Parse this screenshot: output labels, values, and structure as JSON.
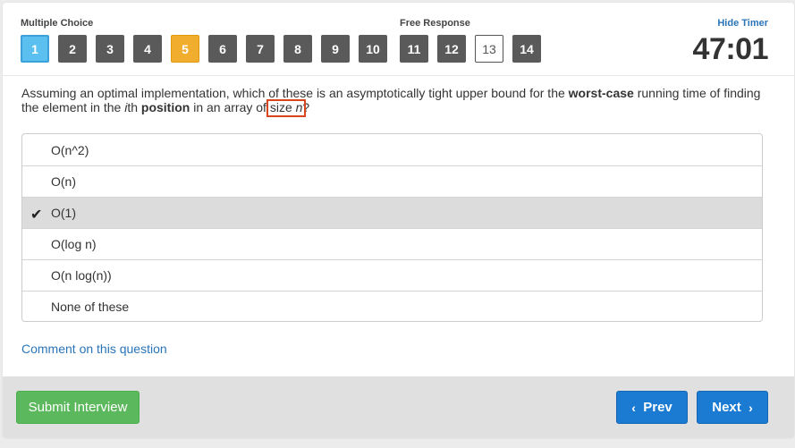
{
  "header": {
    "multiple_choice_label": "Multiple Choice",
    "free_response_label": "Free Response",
    "hide_timer_label": "Hide Timer",
    "timer": "47:01"
  },
  "question_nav": {
    "items": [
      {
        "label": "1",
        "state": "active"
      },
      {
        "label": "2",
        "state": "answered"
      },
      {
        "label": "3",
        "state": "answered"
      },
      {
        "label": "4",
        "state": "answered"
      },
      {
        "label": "5",
        "state": "flagged"
      },
      {
        "label": "6",
        "state": "answered"
      },
      {
        "label": "7",
        "state": "answered"
      },
      {
        "label": "8",
        "state": "answered"
      },
      {
        "label": "9",
        "state": "answered"
      },
      {
        "label": "10",
        "state": "answered"
      },
      {
        "label": "11",
        "state": "answered"
      },
      {
        "label": "12",
        "state": "answered"
      },
      {
        "label": "13",
        "state": "unanswered"
      },
      {
        "label": "14",
        "state": "answered"
      }
    ]
  },
  "question": {
    "part1": "Assuming an optimal implementation, which of these is an asymptotically tight upper bound for the ",
    "bold1": "worst-case",
    "part2": " running time of finding the element in the ",
    "italic_i": "i",
    "part3": "th ",
    "bold2": "position",
    "part4": " in an ",
    "highlight": "array",
    "part5": " of size ",
    "italic_n": "n",
    "part6": "?"
  },
  "options": [
    {
      "label": "O(n^2)",
      "selected": false
    },
    {
      "label": "O(n)",
      "selected": false
    },
    {
      "label": "O(1)",
      "selected": true
    },
    {
      "label": "O(log n)",
      "selected": false
    },
    {
      "label": "O(n log(n))",
      "selected": false
    },
    {
      "label": "None of these",
      "selected": false
    }
  ],
  "check_icon": "✔",
  "comment_link": "Comment on this question",
  "footer": {
    "submit_label": "Submit Interview",
    "prev_label": "Prev",
    "next_label": "Next"
  },
  "colors": {
    "active": "#5bc0f0",
    "flagged": "#f0ad2e",
    "answered": "#5a5a5a",
    "primary": "#1b7bd2",
    "success": "#5cb85c",
    "highlight_box": "#d9451f"
  }
}
